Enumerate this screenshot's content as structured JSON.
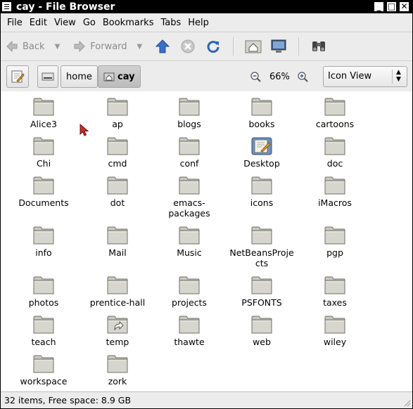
{
  "window": {
    "title": "cay - File Browser"
  },
  "titlebar_buttons": [
    "_",
    "□",
    "✕"
  ],
  "menu": [
    "File",
    "Edit",
    "View",
    "Go",
    "Bookmarks",
    "Tabs",
    "Help"
  ],
  "toolbar": {
    "back_label": "Back",
    "forward_label": "Forward"
  },
  "location": {
    "crumbs": [
      "home",
      "cay"
    ]
  },
  "zoom": {
    "level": "66%"
  },
  "view_mode": "Icon View",
  "files": [
    {
      "name": "Alice3",
      "icon": "folder-icon"
    },
    {
      "name": "ap",
      "icon": "folder-icon"
    },
    {
      "name": "blogs",
      "icon": "folder-icon"
    },
    {
      "name": "books",
      "icon": "folder-icon"
    },
    {
      "name": "cartoons",
      "icon": "folder-icon"
    },
    {
      "name": "Chi",
      "icon": "folder-icon"
    },
    {
      "name": "cmd",
      "icon": "folder-icon"
    },
    {
      "name": "conf",
      "icon": "folder-icon"
    },
    {
      "name": "Desktop",
      "icon": "desktop-icon"
    },
    {
      "name": "doc",
      "icon": "folder-icon"
    },
    {
      "name": "Documents",
      "icon": "folder-icon"
    },
    {
      "name": "dot",
      "icon": "folder-icon"
    },
    {
      "name": "emacs-\npackages",
      "icon": "folder-icon"
    },
    {
      "name": "icons",
      "icon": "folder-icon"
    },
    {
      "name": "iMacros",
      "icon": "folder-icon"
    },
    {
      "name": "info",
      "icon": "folder-icon"
    },
    {
      "name": "Mail",
      "icon": "folder-icon"
    },
    {
      "name": "Music",
      "icon": "folder-icon"
    },
    {
      "name": "NetBeansProje\ncts",
      "icon": "folder-icon"
    },
    {
      "name": "pgp",
      "icon": "folder-icon"
    },
    {
      "name": "photos",
      "icon": "folder-icon"
    },
    {
      "name": "prentice-hall",
      "icon": "folder-icon"
    },
    {
      "name": "projects",
      "icon": "folder-icon"
    },
    {
      "name": "PSFONTS",
      "icon": "folder-icon"
    },
    {
      "name": "taxes",
      "icon": "folder-icon"
    },
    {
      "name": "teach",
      "icon": "folder-icon"
    },
    {
      "name": "temp",
      "icon": "folder-link-icon"
    },
    {
      "name": "thawte",
      "icon": "folder-icon"
    },
    {
      "name": "web",
      "icon": "folder-icon"
    },
    {
      "name": "wiley",
      "icon": "folder-icon"
    },
    {
      "name": "workspace",
      "icon": "folder-icon"
    },
    {
      "name": "zork",
      "icon": "folder-icon"
    }
  ],
  "status": {
    "text": "32 items, Free space: 8.9 GB"
  }
}
